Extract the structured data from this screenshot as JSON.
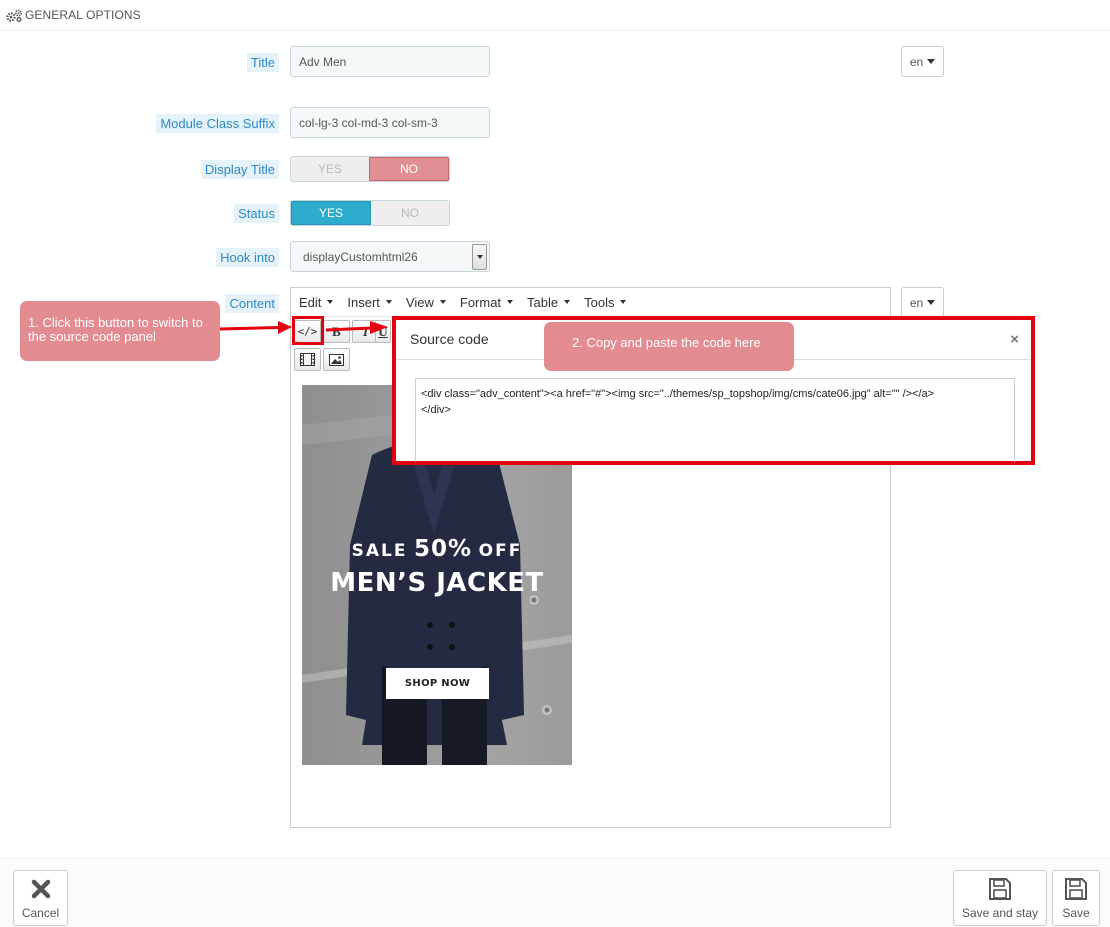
{
  "panel": {
    "title": "GENERAL OPTIONS",
    "icon": "gears-icon"
  },
  "form": {
    "title_label": "Title",
    "title_value": "Adv Men",
    "lang": "en",
    "suffix_label": "Module Class Suffix",
    "suffix_value": "col-lg-3 col-md-3 col-sm-3",
    "display_title_label": "Display Title",
    "status_label": "Status",
    "yes": "YES",
    "no": "NO",
    "display_title_value": "NO",
    "status_value": "YES",
    "hook_label": "Hook into",
    "hook_value": "displayCustomhtml26",
    "content_label": "Content"
  },
  "editor": {
    "menus": [
      "Edit",
      "Insert",
      "View",
      "Format",
      "Table",
      "Tools"
    ],
    "toolbar": {
      "source_code": "</>",
      "bold": "B",
      "italic": "I",
      "underline": "U"
    }
  },
  "promo": {
    "sale_word": "SALE",
    "sale_percent": "50%",
    "sale_off": "OFF",
    "headline": "MEN’S JACKET",
    "cta": "SHOP NOW"
  },
  "dialog": {
    "title": "Source code",
    "close": "×",
    "code": "<div class=\"adv_content\"><a href=\"#\"><img src=\"../themes/sp_topshop/img/cms/cate06.jpg\" alt=\"\" /></a>\n</div>"
  },
  "callouts": {
    "step1": "1. Click this button to switch to the source code panel",
    "step2": "2. Copy and paste the code here"
  },
  "colors": {
    "highlight": "#e3000f",
    "callout": "#e28b90",
    "yes": "#2eacce",
    "no": "#e08f95"
  },
  "footer": {
    "cancel": "Cancel",
    "save_stay": "Save and stay",
    "save": "Save"
  }
}
